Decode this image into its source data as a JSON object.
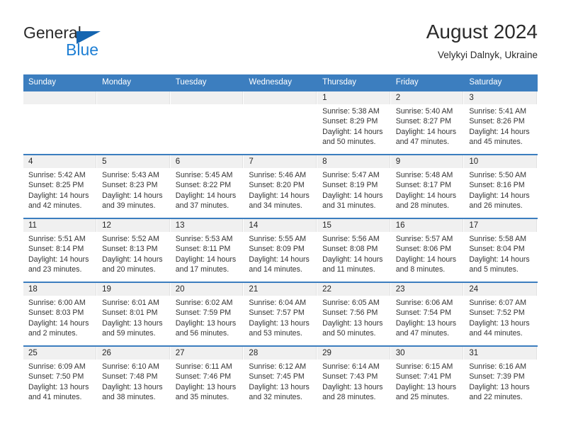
{
  "brand": {
    "name_part1": "General",
    "name_part2": "Blue",
    "triangle_color": "#1565b0",
    "blue_color": "#1e7fd4"
  },
  "header": {
    "title": "August 2024",
    "subtitle": "Velykyi Dalnyk, Ukraine"
  },
  "theme": {
    "header_bg": "#3c7ebf",
    "daynum_bg": "#f0f0f0",
    "text": "#343434"
  },
  "calendar": {
    "weekday_headers": [
      "Sunday",
      "Monday",
      "Tuesday",
      "Wednesday",
      "Thursday",
      "Friday",
      "Saturday"
    ],
    "weeks": [
      [
        {
          "day": "",
          "sunrise": "",
          "sunset": "",
          "daylight_line1": "",
          "daylight_line2": ""
        },
        {
          "day": "",
          "sunrise": "",
          "sunset": "",
          "daylight_line1": "",
          "daylight_line2": ""
        },
        {
          "day": "",
          "sunrise": "",
          "sunset": "",
          "daylight_line1": "",
          "daylight_line2": ""
        },
        {
          "day": "",
          "sunrise": "",
          "sunset": "",
          "daylight_line1": "",
          "daylight_line2": ""
        },
        {
          "day": "1",
          "sunrise": "Sunrise: 5:38 AM",
          "sunset": "Sunset: 8:29 PM",
          "daylight_line1": "Daylight: 14 hours",
          "daylight_line2": "and 50 minutes."
        },
        {
          "day": "2",
          "sunrise": "Sunrise: 5:40 AM",
          "sunset": "Sunset: 8:27 PM",
          "daylight_line1": "Daylight: 14 hours",
          "daylight_line2": "and 47 minutes."
        },
        {
          "day": "3",
          "sunrise": "Sunrise: 5:41 AM",
          "sunset": "Sunset: 8:26 PM",
          "daylight_line1": "Daylight: 14 hours",
          "daylight_line2": "and 45 minutes."
        }
      ],
      [
        {
          "day": "4",
          "sunrise": "Sunrise: 5:42 AM",
          "sunset": "Sunset: 8:25 PM",
          "daylight_line1": "Daylight: 14 hours",
          "daylight_line2": "and 42 minutes."
        },
        {
          "day": "5",
          "sunrise": "Sunrise: 5:43 AM",
          "sunset": "Sunset: 8:23 PM",
          "daylight_line1": "Daylight: 14 hours",
          "daylight_line2": "and 39 minutes."
        },
        {
          "day": "6",
          "sunrise": "Sunrise: 5:45 AM",
          "sunset": "Sunset: 8:22 PM",
          "daylight_line1": "Daylight: 14 hours",
          "daylight_line2": "and 37 minutes."
        },
        {
          "day": "7",
          "sunrise": "Sunrise: 5:46 AM",
          "sunset": "Sunset: 8:20 PM",
          "daylight_line1": "Daylight: 14 hours",
          "daylight_line2": "and 34 minutes."
        },
        {
          "day": "8",
          "sunrise": "Sunrise: 5:47 AM",
          "sunset": "Sunset: 8:19 PM",
          "daylight_line1": "Daylight: 14 hours",
          "daylight_line2": "and 31 minutes."
        },
        {
          "day": "9",
          "sunrise": "Sunrise: 5:48 AM",
          "sunset": "Sunset: 8:17 PM",
          "daylight_line1": "Daylight: 14 hours",
          "daylight_line2": "and 28 minutes."
        },
        {
          "day": "10",
          "sunrise": "Sunrise: 5:50 AM",
          "sunset": "Sunset: 8:16 PM",
          "daylight_line1": "Daylight: 14 hours",
          "daylight_line2": "and 26 minutes."
        }
      ],
      [
        {
          "day": "11",
          "sunrise": "Sunrise: 5:51 AM",
          "sunset": "Sunset: 8:14 PM",
          "daylight_line1": "Daylight: 14 hours",
          "daylight_line2": "and 23 minutes."
        },
        {
          "day": "12",
          "sunrise": "Sunrise: 5:52 AM",
          "sunset": "Sunset: 8:13 PM",
          "daylight_line1": "Daylight: 14 hours",
          "daylight_line2": "and 20 minutes."
        },
        {
          "day": "13",
          "sunrise": "Sunrise: 5:53 AM",
          "sunset": "Sunset: 8:11 PM",
          "daylight_line1": "Daylight: 14 hours",
          "daylight_line2": "and 17 minutes."
        },
        {
          "day": "14",
          "sunrise": "Sunrise: 5:55 AM",
          "sunset": "Sunset: 8:09 PM",
          "daylight_line1": "Daylight: 14 hours",
          "daylight_line2": "and 14 minutes."
        },
        {
          "day": "15",
          "sunrise": "Sunrise: 5:56 AM",
          "sunset": "Sunset: 8:08 PM",
          "daylight_line1": "Daylight: 14 hours",
          "daylight_line2": "and 11 minutes."
        },
        {
          "day": "16",
          "sunrise": "Sunrise: 5:57 AM",
          "sunset": "Sunset: 8:06 PM",
          "daylight_line1": "Daylight: 14 hours",
          "daylight_line2": "and 8 minutes."
        },
        {
          "day": "17",
          "sunrise": "Sunrise: 5:58 AM",
          "sunset": "Sunset: 8:04 PM",
          "daylight_line1": "Daylight: 14 hours",
          "daylight_line2": "and 5 minutes."
        }
      ],
      [
        {
          "day": "18",
          "sunrise": "Sunrise: 6:00 AM",
          "sunset": "Sunset: 8:03 PM",
          "daylight_line1": "Daylight: 14 hours",
          "daylight_line2": "and 2 minutes."
        },
        {
          "day": "19",
          "sunrise": "Sunrise: 6:01 AM",
          "sunset": "Sunset: 8:01 PM",
          "daylight_line1": "Daylight: 13 hours",
          "daylight_line2": "and 59 minutes."
        },
        {
          "day": "20",
          "sunrise": "Sunrise: 6:02 AM",
          "sunset": "Sunset: 7:59 PM",
          "daylight_line1": "Daylight: 13 hours",
          "daylight_line2": "and 56 minutes."
        },
        {
          "day": "21",
          "sunrise": "Sunrise: 6:04 AM",
          "sunset": "Sunset: 7:57 PM",
          "daylight_line1": "Daylight: 13 hours",
          "daylight_line2": "and 53 minutes."
        },
        {
          "day": "22",
          "sunrise": "Sunrise: 6:05 AM",
          "sunset": "Sunset: 7:56 PM",
          "daylight_line1": "Daylight: 13 hours",
          "daylight_line2": "and 50 minutes."
        },
        {
          "day": "23",
          "sunrise": "Sunrise: 6:06 AM",
          "sunset": "Sunset: 7:54 PM",
          "daylight_line1": "Daylight: 13 hours",
          "daylight_line2": "and 47 minutes."
        },
        {
          "day": "24",
          "sunrise": "Sunrise: 6:07 AM",
          "sunset": "Sunset: 7:52 PM",
          "daylight_line1": "Daylight: 13 hours",
          "daylight_line2": "and 44 minutes."
        }
      ],
      [
        {
          "day": "25",
          "sunrise": "Sunrise: 6:09 AM",
          "sunset": "Sunset: 7:50 PM",
          "daylight_line1": "Daylight: 13 hours",
          "daylight_line2": "and 41 minutes."
        },
        {
          "day": "26",
          "sunrise": "Sunrise: 6:10 AM",
          "sunset": "Sunset: 7:48 PM",
          "daylight_line1": "Daylight: 13 hours",
          "daylight_line2": "and 38 minutes."
        },
        {
          "day": "27",
          "sunrise": "Sunrise: 6:11 AM",
          "sunset": "Sunset: 7:46 PM",
          "daylight_line1": "Daylight: 13 hours",
          "daylight_line2": "and 35 minutes."
        },
        {
          "day": "28",
          "sunrise": "Sunrise: 6:12 AM",
          "sunset": "Sunset: 7:45 PM",
          "daylight_line1": "Daylight: 13 hours",
          "daylight_line2": "and 32 minutes."
        },
        {
          "day": "29",
          "sunrise": "Sunrise: 6:14 AM",
          "sunset": "Sunset: 7:43 PM",
          "daylight_line1": "Daylight: 13 hours",
          "daylight_line2": "and 28 minutes."
        },
        {
          "day": "30",
          "sunrise": "Sunrise: 6:15 AM",
          "sunset": "Sunset: 7:41 PM",
          "daylight_line1": "Daylight: 13 hours",
          "daylight_line2": "and 25 minutes."
        },
        {
          "day": "31",
          "sunrise": "Sunrise: 6:16 AM",
          "sunset": "Sunset: 7:39 PM",
          "daylight_line1": "Daylight: 13 hours",
          "daylight_line2": "and 22 minutes."
        }
      ]
    ]
  }
}
